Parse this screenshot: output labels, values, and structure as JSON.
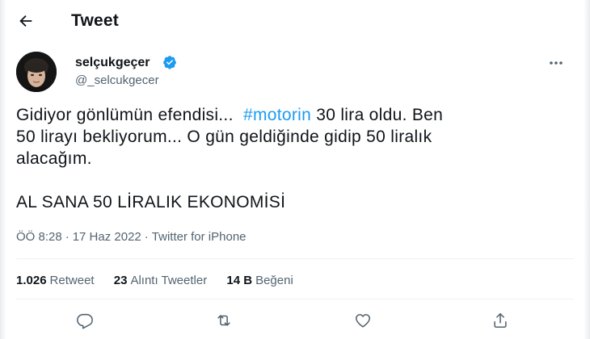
{
  "header": {
    "title": "Tweet"
  },
  "author": {
    "display_name": "selçukgeçer",
    "handle": "@_selcukgecer"
  },
  "tweet": {
    "line1_before": "Gidiyor gönlümün efendisi...",
    "line1_hashtag": "#motorin",
    "line1_after": "30 lira oldu. Ben",
    "line2": "50 lirayı bekliyorum... O gün geldiğinde gidip 50 liralık",
    "line3": "alacağım.",
    "line5": "AL SANA 50 LİRALIK EKONOMİSİ"
  },
  "meta": {
    "time": "ÖÖ 8:28",
    "date": "17 Haz 2022",
    "source": "Twitter for iPhone",
    "separator": "·"
  },
  "stats": {
    "retweets_count": "1.026",
    "retweets_label": "Retweet",
    "quotes_count": "23",
    "quotes_label": "Alıntı Tweetler",
    "likes_count": "14 B",
    "likes_label": "Beğeni"
  },
  "icons": {
    "back": "back-arrow-icon",
    "verified": "verified-badge-icon",
    "more": "more-icon",
    "reply": "reply-icon",
    "retweet": "retweet-icon",
    "like": "like-icon",
    "share": "share-icon"
  },
  "colors": {
    "accent": "#1d9bf0",
    "text": "#0f1419",
    "secondary": "#536471",
    "divider": "#eff3f4"
  }
}
